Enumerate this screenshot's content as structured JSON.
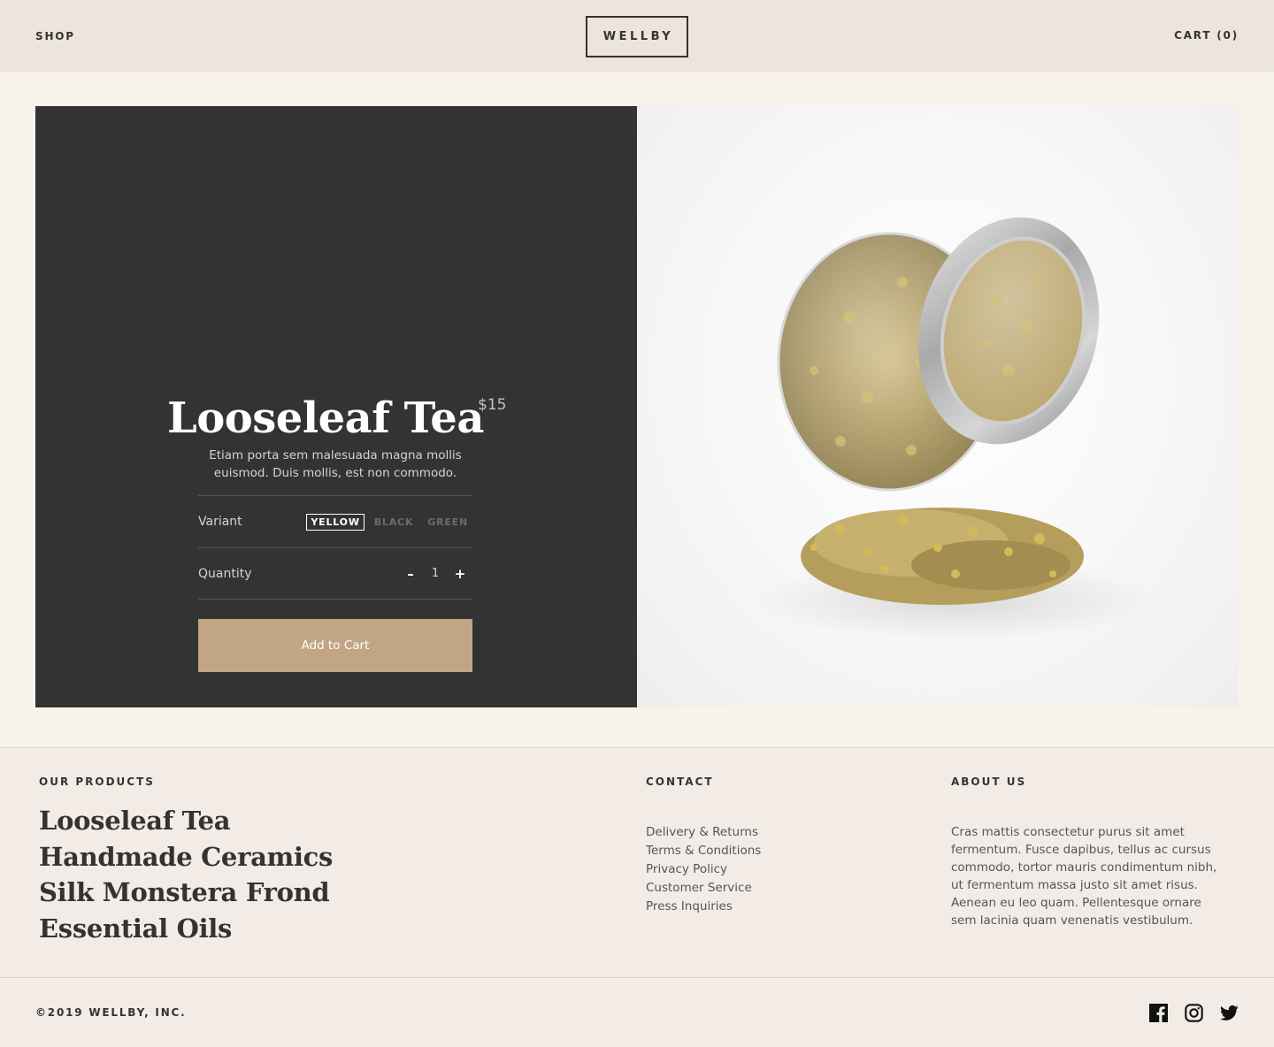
{
  "header": {
    "shop_label": "SHOP",
    "logo_text": "WELLBY",
    "cart_label": "CART (0)"
  },
  "product": {
    "title": "Looseleaf Tea",
    "price": "$15",
    "description": "Etiam porta sem malesuada magna mollis euismod. Duis mollis, est non commodo.",
    "variant_label": "Variant",
    "variants": [
      "YELLOW",
      "BLACK",
      "GREEN"
    ],
    "selected_variant": "YELLOW",
    "quantity_label": "Quantity",
    "quantity": "1",
    "decrement_symbol": "–",
    "increment_symbol": "+",
    "add_to_cart_label": "Add to Cart",
    "image_icon": "tea-jar-image"
  },
  "footer": {
    "products_heading": "OUR PRODUCTS",
    "products": [
      "Looseleaf Tea",
      "Handmade Ceramics",
      "Silk Monstera Frond",
      "Essential Oils"
    ],
    "contact_heading": "CONTACT",
    "contact_links": [
      "Delivery & Returns",
      "Terms & Conditions",
      "Privacy Policy",
      "Customer Service",
      "Press Inquiries"
    ],
    "about_heading": "ABOUT US",
    "about_text": "Cras mattis consectetur purus sit amet fermentum. Fusce dapibus, tellus ac cursus commodo, tortor mauris condimentum nibh, ut fermentum massa justo sit amet risus. Aenean eu leo quam. Pellentesque ornare sem lacinia quam venenatis vestibulum.",
    "copyright": "©2019 WELLBY, INC.",
    "social_icons": [
      "facebook-icon",
      "instagram-icon",
      "twitter-icon"
    ]
  },
  "colors": {
    "header_bg": "#ede5dc",
    "page_bg": "#f8f3ea",
    "panel_bg": "#333333",
    "accent": "#c1a584",
    "footer_bg": "#f3ece6"
  }
}
